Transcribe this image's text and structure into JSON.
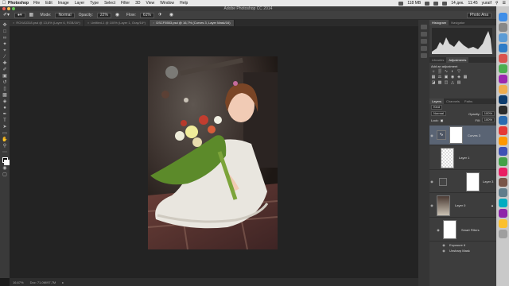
{
  "menubar": {
    "app_name": "Photoshop",
    "items": [
      "File",
      "Edit",
      "Image",
      "Layer",
      "Type",
      "Select",
      "Filter",
      "3D",
      "View",
      "Window",
      "Help"
    ],
    "memory": "118 MB",
    "date": "14 дек.",
    "time": "11:45",
    "user": "yuraif"
  },
  "window_title": "Adobe Photoshop CC 2014",
  "options": {
    "mode_label": "Mode:",
    "mode_value": "Normal",
    "opacity_label": "Opacity:",
    "opacity_value": "22%",
    "flow_label": "Flow:",
    "flow_value": "61%",
    "workspace": "Photo Ana"
  },
  "doc_tabs": [
    {
      "label": "ROXA3318.psd @ 13,6% (Layer 6, RGB/16*)",
      "active": false
    },
    {
      "label": "Untitled-1 @ 100% (Layer 1, Gray/16*)",
      "active": false
    },
    {
      "label": "DSCF5553.psd @ 16,7% (Curves 3, Layer Mask/16)",
      "active": true
    }
  ],
  "status": {
    "zoom": "16,67%",
    "doc": "Doc: 71,0M/97,7M"
  },
  "panels": {
    "histogram_tabs": [
      "Histogram",
      "Navigator"
    ],
    "adjust_tabs": [
      "Libraries",
      "Adjustments"
    ],
    "add_adjustment": "Add an adjustment",
    "layer_tabs": [
      "Layers",
      "Channels",
      "Paths"
    ],
    "kind": "Kind",
    "blend": "Normal",
    "opacity_label": "Opacity:",
    "opacity_value": "100%",
    "lock_label": "Lock:",
    "fill_label": "Fill:",
    "fill_value": "100%",
    "layers": [
      {
        "name": "Curves 3",
        "selected": true
      },
      {
        "name": "Layer 1",
        "selected": false
      },
      {
        "name": "Layer 3",
        "selected": false
      },
      {
        "name": "Layer 0",
        "selected": false
      },
      {
        "name": "Smart Filters",
        "selected": false
      },
      {
        "name": "Exposure 6",
        "selected": false
      },
      {
        "name": "Unsharp Mask",
        "selected": false
      }
    ]
  },
  "colors": {
    "accent": "#5a6474",
    "menubar": "#e8e8e8",
    "canvas": "#232323",
    "panel": "#3d3d3d"
  }
}
